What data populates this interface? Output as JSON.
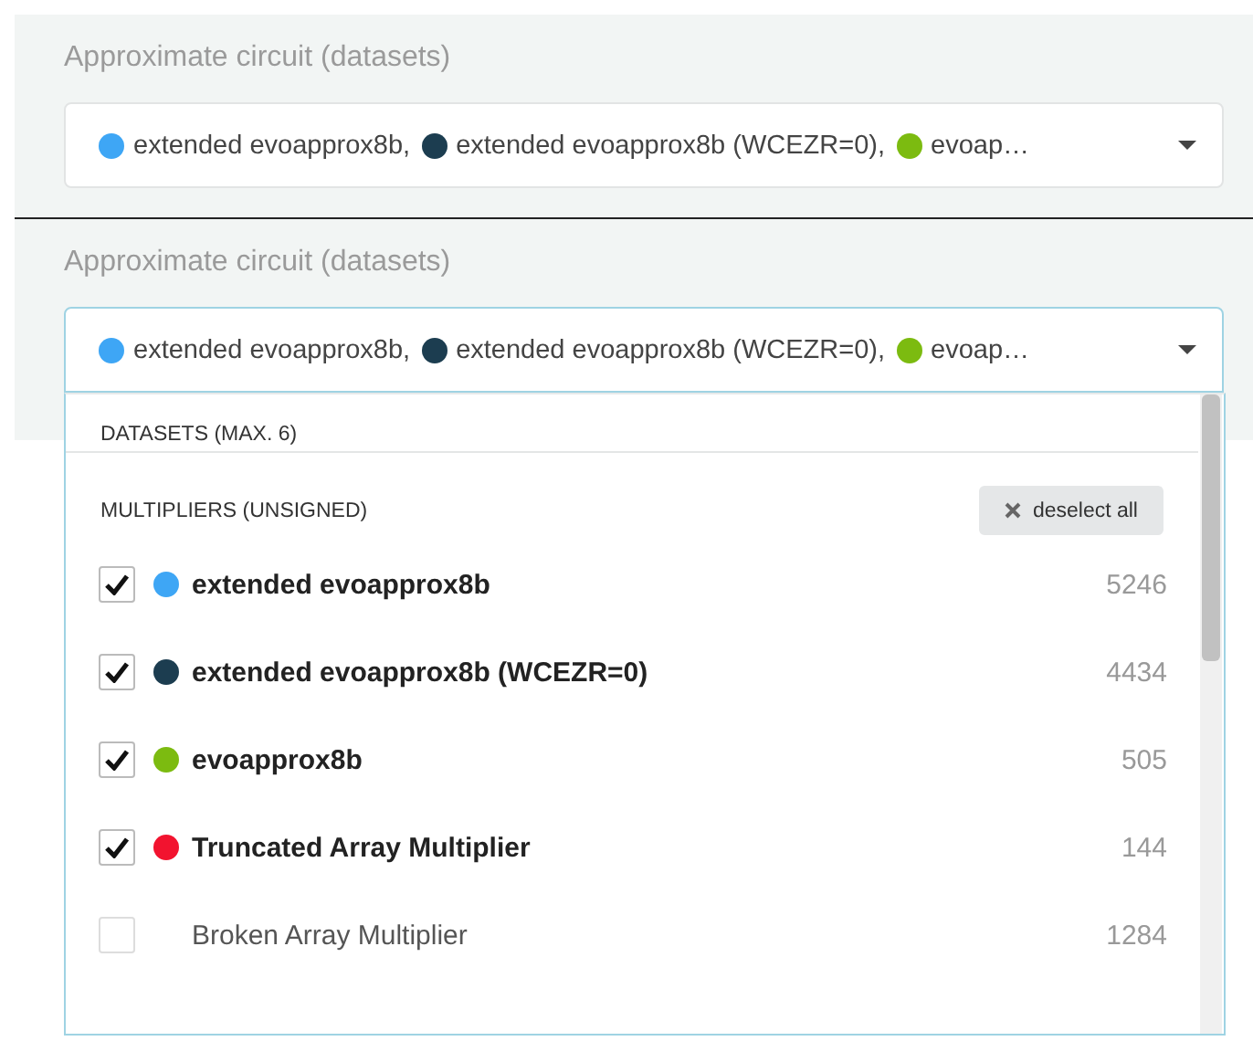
{
  "panels": [
    {
      "label": "Approximate circuit (datasets)",
      "focused": false,
      "summary": [
        {
          "label": "extended evoapprox8b,",
          "color": "#3ea6f5"
        },
        {
          "label": "extended evoapprox8b (WCEZR=0),",
          "color": "#1c3d50"
        },
        {
          "label": "evoap…",
          "color": "#7cbb10"
        }
      ]
    },
    {
      "label": "Approximate circuit (datasets)",
      "focused": true,
      "summary": [
        {
          "label": "extended evoapprox8b,",
          "color": "#3ea6f5"
        },
        {
          "label": "extended evoapprox8b (WCEZR=0),",
          "color": "#1c3d50"
        },
        {
          "label": "evoap…",
          "color": "#7cbb10"
        }
      ]
    }
  ],
  "menu": {
    "header": "DATASETS (MAX. 6)",
    "section": "MULTIPLIERS (UNSIGNED)",
    "deselect_button": "deselect all",
    "items": [
      {
        "label": "extended evoapprox8b",
        "checked": true,
        "color": "#3ea6f5",
        "count": "5246"
      },
      {
        "label": "extended evoapprox8b (WCEZR=0)",
        "checked": true,
        "color": "#1c3d50",
        "count": "4434"
      },
      {
        "label": "evoapprox8b",
        "checked": true,
        "color": "#7cbb10",
        "count": "505"
      },
      {
        "label": "Truncated Array Multiplier",
        "checked": true,
        "color": "#f2132f",
        "count": "144"
      },
      {
        "label": "Broken Array Multiplier",
        "checked": false,
        "count": "1284"
      }
    ]
  }
}
